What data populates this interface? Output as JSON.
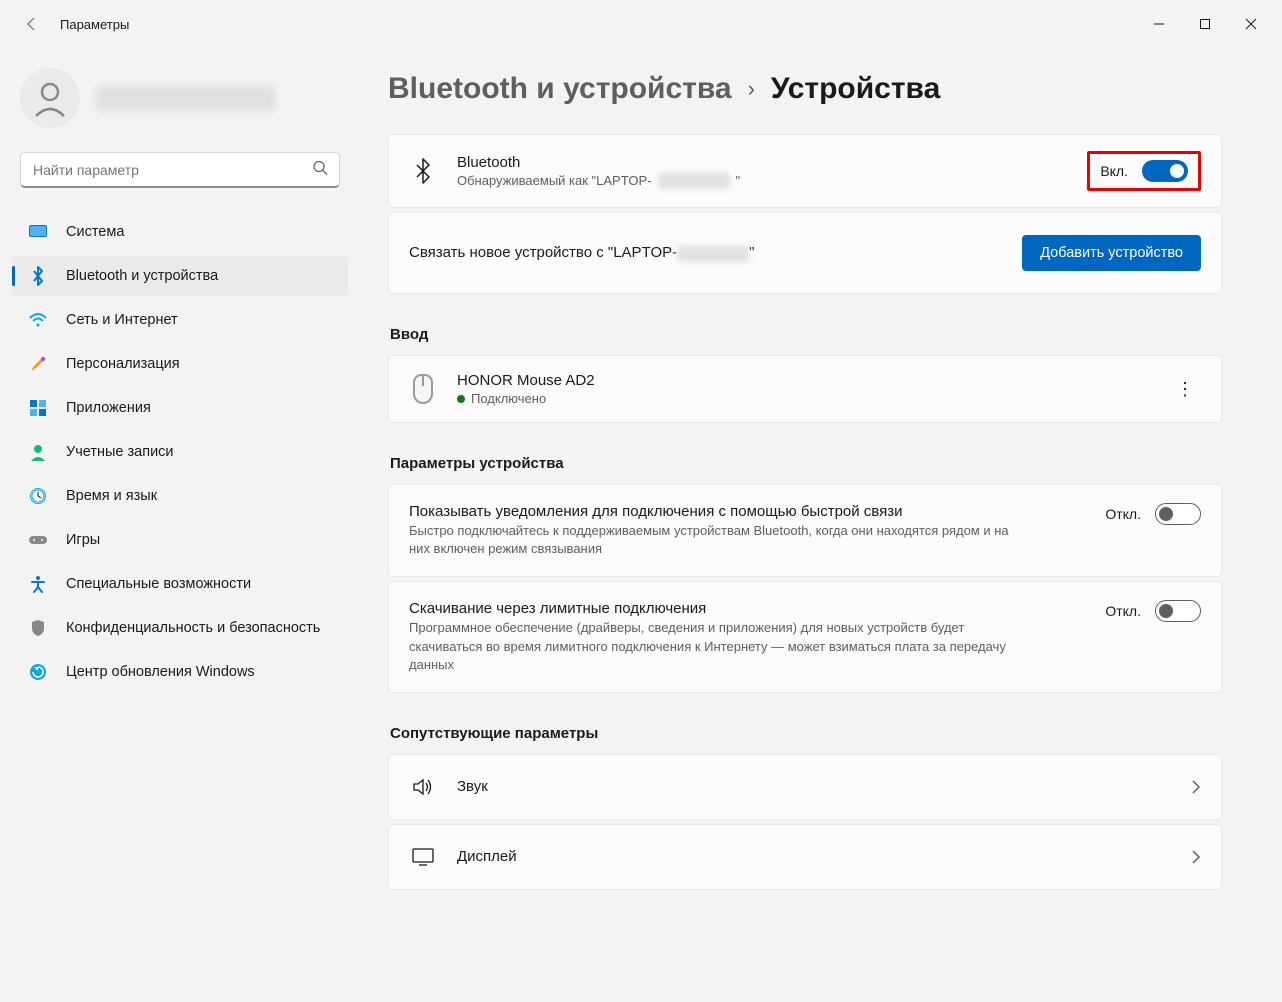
{
  "titlebar": {
    "app_title": "Параметры"
  },
  "search": {
    "placeholder": "Найти параметр"
  },
  "sidebar": {
    "items": [
      {
        "label": "Система"
      },
      {
        "label": "Bluetooth и устройства"
      },
      {
        "label": "Сеть и Интернет"
      },
      {
        "label": "Персонализация"
      },
      {
        "label": "Приложения"
      },
      {
        "label": "Учетные записи"
      },
      {
        "label": "Время и язык"
      },
      {
        "label": "Игры"
      },
      {
        "label": "Специальные возможности"
      },
      {
        "label": "Конфиденциальность и безопасность"
      },
      {
        "label": "Центр обновления Windows"
      }
    ]
  },
  "breadcrumb": {
    "parent": "Bluetooth и устройства",
    "current": "Устройства"
  },
  "bluetooth": {
    "title": "Bluetooth",
    "sub_prefix": "Обнаруживаемый как \"LAPTOP-",
    "sub_suffix": "\"",
    "status": "Вкл."
  },
  "pair": {
    "text_prefix": "Связать новое устройство с \"LAPTOP-",
    "text_suffix": "\"",
    "button": "Добавить устройство"
  },
  "sections": {
    "input": "Ввод",
    "device_settings": "Параметры устройства",
    "related": "Сопутствующие параметры"
  },
  "device": {
    "name": "HONOR Mouse AD2",
    "status": "Подключено"
  },
  "settings": [
    {
      "title": "Показывать уведомления для подключения с помощью быстрой связи",
      "sub": "Быстро подключайтесь к поддерживаемым устройствам Bluetooth, когда они находятся рядом и на них включен режим связывания",
      "status": "Откл."
    },
    {
      "title": "Скачивание через лимитные подключения",
      "sub": "Программное обеспечение (драйверы, сведения и приложения) для новых устройств будет скачиваться во время лимитного подключения к Интернету — может взиматься плата за передачу данных",
      "status": "Откл."
    }
  ],
  "related": [
    {
      "label": "Звук"
    },
    {
      "label": "Дисплей"
    }
  ]
}
